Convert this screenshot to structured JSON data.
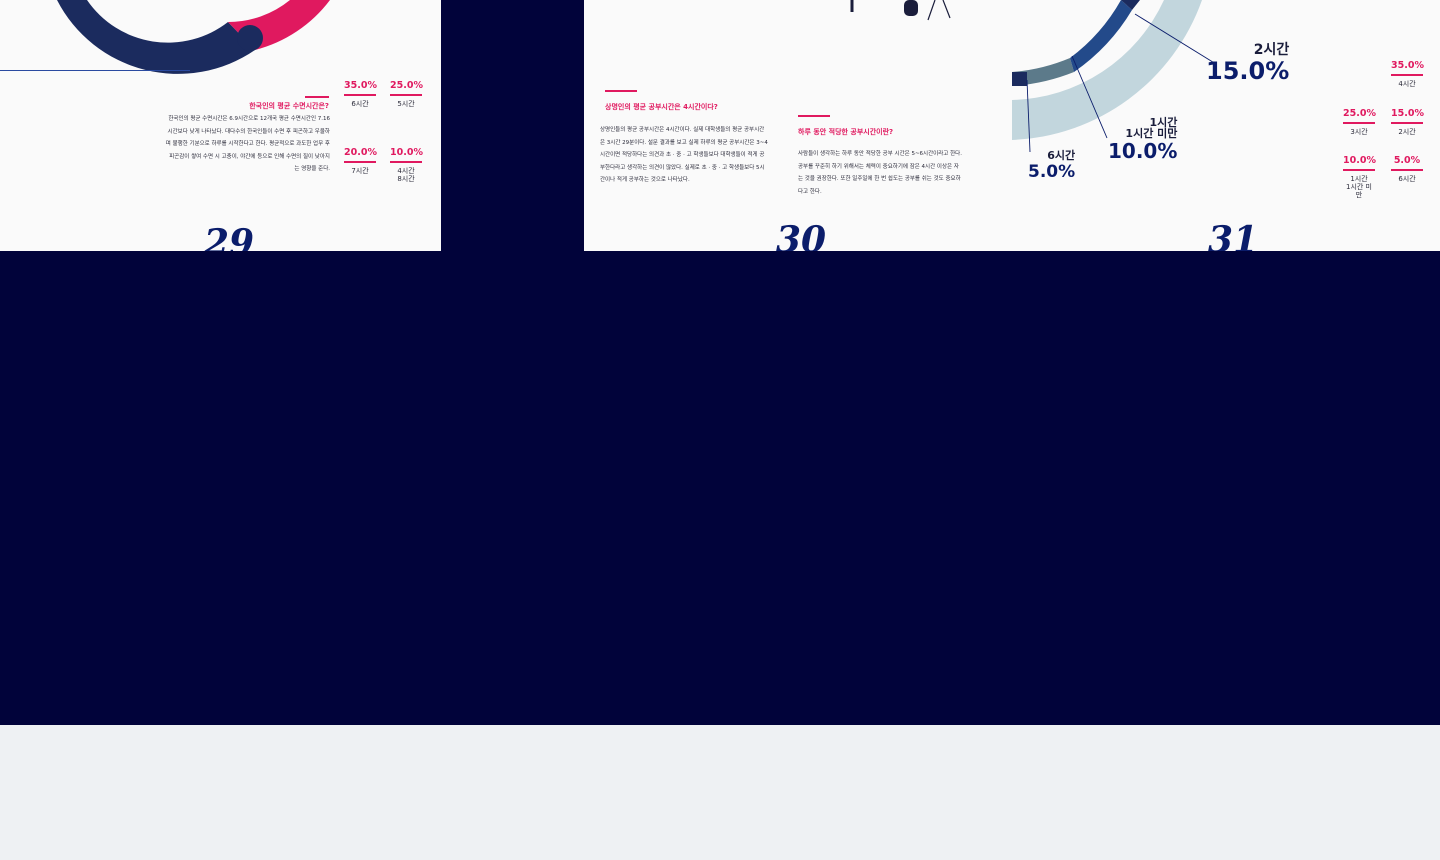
{
  "page29": {
    "heading": "한국인의 평균 수면시간은?",
    "body": "한국인의 평균 수면시간은 6.9시간으로 12개국 평균 수면시간인 7.16시간보다 낮게 나타났다. 대다수의 한국인들이 수면 후 피곤하고 우울하며 불행한 기분으로 하루를 시작한다고 한다. 평균적으로 과도한 업무 후 피곤감이 쌓여 수면 시 고충이, 야간에 등으로 인해 수면의 질이 낮아지는 영향을 준다.",
    "stats": [
      {
        "pct": "35.0%",
        "label": "6시간"
      },
      {
        "pct": "25.0%",
        "label": "5시간"
      },
      {
        "pct": "20.0%",
        "label": "7시간"
      },
      {
        "pct": "10.0%",
        "label": "4시간\n8시간"
      }
    ],
    "page_number": "29"
  },
  "page30": {
    "heading1": "상명인의 평균 공부시간은 4시간이다?",
    "body1": "상명인들의 평균 공부시간은 4시간이다. 실제 대학생들의 평균 공부시간은 3시간 29분이다. 설문 결과를 보고 실제 하루의 평균 공부시간은 3~4시간이면 적당하다는 의견과 초 · 중 · 고 학생들보다 대학생들이 적게 공부한다라고 생각하는 의견이 많았다. 실제로 초 · 중 · 고 학생들보다 5시간이나 적게 공부하는 것으로 나타났다.",
    "heading2": "하루 동안 적당한 공부시간이란?",
    "body2": "사람들이 생각하는 하루 동안 적당한 공부 시간은 5~6시간이라고 한다. 공부를 꾸준히 하기 위해서는 체력이 중요하기에 잠은 4시간 이상은 자는 것을 권장한다. 또한 일주일에 한 번 쉽도는 공부를 쉬는 것도 중요하다고 한다.",
    "page_number": "30"
  },
  "page31": {
    "callouts": [
      {
        "title": "2시간",
        "value": "15.0%"
      },
      {
        "title": "1시간\n1시간 미만",
        "value": "10.0%"
      },
      {
        "title": "6시간",
        "value": "5.0%"
      }
    ],
    "stats": [
      {
        "pct": "35.0%",
        "label": "4시간"
      },
      {
        "pct": "25.0%",
        "label": "3시간"
      },
      {
        "pct": "15.0%",
        "label": "2시간"
      },
      {
        "pct": "10.0%",
        "label": "1시간\n1시간 미만"
      },
      {
        "pct": "5.0%",
        "label": "6시간"
      }
    ],
    "page_number": "31"
  },
  "colors": {
    "navy": "#01033a",
    "deep_blue": "#1b2b5e",
    "pink": "#e0195f",
    "light_blue": "#c2d6dd",
    "mid_blue": "#234a8a",
    "slate": "#5c7a8a"
  }
}
